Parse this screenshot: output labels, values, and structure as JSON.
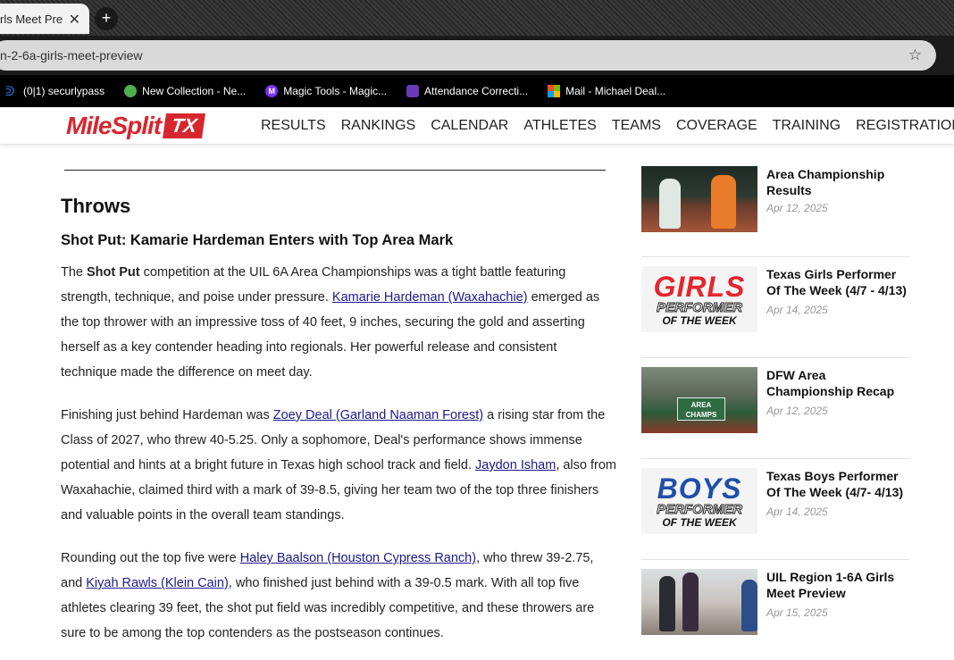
{
  "browser": {
    "tab_title": "rls Meet Pre",
    "new_tab": "+",
    "url": "n-2-6a-girls-meet-preview",
    "bookmarks": [
      {
        "label": "(0|1) securlypass",
        "icon": "securly-icon",
        "color": "#2c7be5"
      },
      {
        "label": "New Collection - Ne...",
        "icon": "collection-icon",
        "color": "#4caf50"
      },
      {
        "label": "Magic Tools - Magic...",
        "icon": "magic-icon",
        "color": "#7b2ff7"
      },
      {
        "label": "Attendance Correcti...",
        "icon": "forms-icon",
        "color": "#673ab7"
      },
      {
        "label": "Mail - Michael Deal...",
        "icon": "microsoft-icon",
        "color": "#f25022"
      }
    ]
  },
  "site": {
    "logo_text": "MileSplit",
    "logo_badge": "TX",
    "nav": [
      "RESULTS",
      "RANKINGS",
      "CALENDAR",
      "ATHLETES",
      "TEAMS",
      "COVERAGE",
      "TRAINING",
      "REGISTRATION"
    ]
  },
  "article": {
    "section_heading": "Throws",
    "sub_heading": "Shot Put: Kamarie Hardeman Enters with Top Area Mark",
    "p1": {
      "a": "The ",
      "bold": "Shot Put",
      "b": " competition at the UIL 6A Area Championships was a tight battle featuring strength, technique, and poise under pressure. ",
      "link1": "Kamarie Hardeman (Waxahachie)",
      "c": " emerged as the top thrower with an impressive toss of 40 feet, 9 inches, securing the gold and asserting herself as a key contender heading into regionals. Her powerful release and consistent technique made the difference on meet day."
    },
    "p2": {
      "a": "Finishing just behind Hardeman was ",
      "link1": "Zoey Deal (Garland Naaman Forest)",
      "b": " a rising star from the Class of 2027, who threw 40-5.25. Only a sophomore, Deal's performance shows immense potential and hints at a bright future in Texas high school track and field. ",
      "link2": "Jaydon Isham",
      "c": ", also from Waxahachie, claimed third with a mark of 39-8.5, giving her team two of the top three finishers and valuable points in the overall team standings."
    },
    "p3": {
      "a": "Rounding out the top five were ",
      "link1": "Haley Baalson (Houston Cypress Ranch)",
      "b": ", who threw 39-2.75, and ",
      "link2": "Kiyah Rawls (Klein Cain)",
      "c": ", who finished just behind with a 39-0.5 mark. With all top five athletes clearing 39 feet, the shot put field was incredibly competitive, and these throwers are sure to be among the top contenders as the postseason continues."
    }
  },
  "sidebar": {
    "cards": [
      {
        "title": "Area Championship Results",
        "date": "Apr 12, 2025"
      },
      {
        "title": "Texas Girls Performer Of The Week (4/7 - 4/13)",
        "date": "Apr 14, 2025",
        "thumb_big": "GIRLS",
        "thumb_mid": "PERFORMER",
        "thumb_small": "OF THE WEEK",
        "accent": "#e3262f"
      },
      {
        "title": "DFW Area Championship Recap",
        "date": "Apr 12, 2025",
        "banner": "AREA CHAMPS"
      },
      {
        "title": "Texas Boys Performer Of The Week (4/7- 4/13)",
        "date": "Apr 14, 2025",
        "thumb_big": "BOYS",
        "thumb_mid": "PERFORMER",
        "thumb_small": "OF THE WEEK",
        "accent": "#1f4fa8"
      },
      {
        "title": "UIL Region 1-6A Girls Meet Preview",
        "date": "Apr 15, 2025"
      }
    ]
  }
}
